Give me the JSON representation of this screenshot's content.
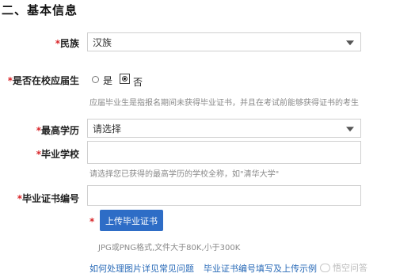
{
  "section": {
    "title": "二、基本信息"
  },
  "fields": {
    "ethnicity": {
      "required_mark": "*",
      "label": "民族",
      "value": "汉族"
    },
    "fresh_graduate": {
      "required_mark": "*",
      "label": "是否在校应届生",
      "options": [
        {
          "label": "是",
          "selected": false
        },
        {
          "label": "否",
          "selected": true
        }
      ],
      "hint": "应届毕业生是指报名期间未获得毕业证书，并且在考试前能够获得证书的考生"
    },
    "education": {
      "required_mark": "*",
      "label": "最高学历",
      "value": "请选择"
    },
    "school": {
      "required_mark": "*",
      "label": "毕业学校",
      "value": "",
      "hint": "请选择您已获得的最高学历的学校全称，如\"清华大学\""
    },
    "certificate_no": {
      "required_mark": "*",
      "label": "毕业证书编号",
      "value": ""
    },
    "upload": {
      "required_mark": "*",
      "button_label": "上传毕业证书",
      "hint": "JPG或PNG格式,文件大于80K,小于300K"
    }
  },
  "links": {
    "faq": "如何处理图片详见常见问题",
    "example": "毕业证书编号填写及上传示例"
  },
  "watermark": {
    "text": "悟空问答"
  }
}
